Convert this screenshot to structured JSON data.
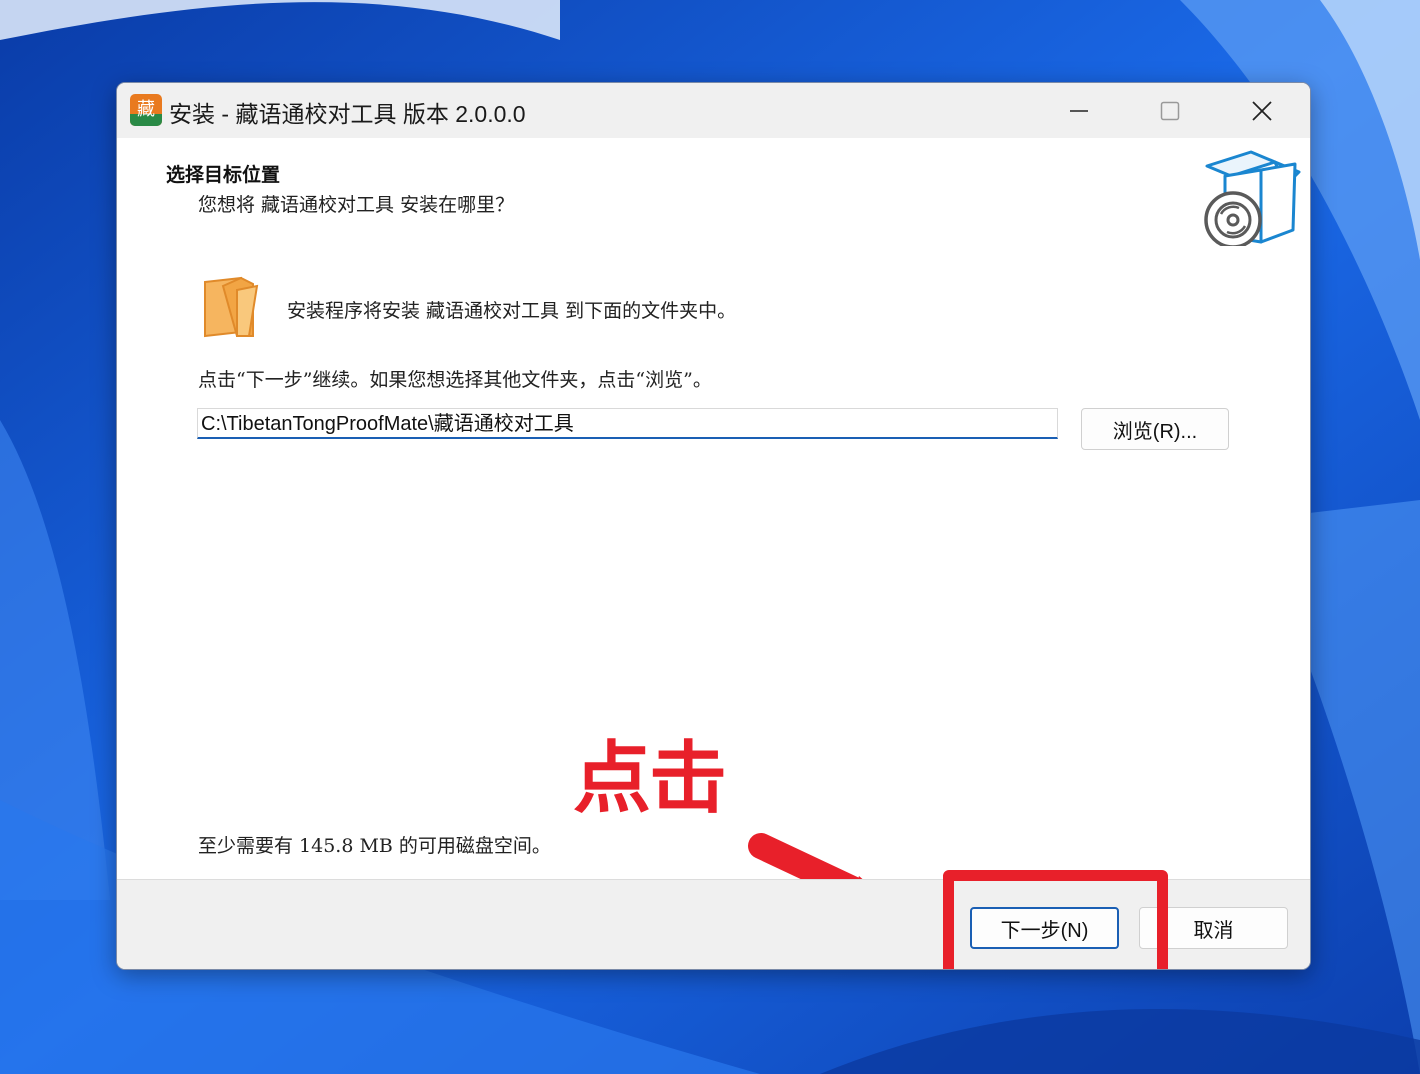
{
  "window": {
    "title": "安装 - 藏语通校对工具 版本 2.0.0.0",
    "app_icon_glyph": "藏",
    "controls": [
      "minimize-icon",
      "maximize-icon",
      "close-icon"
    ]
  },
  "page": {
    "heading": "选择目标位置",
    "subheading": "您想将 藏语通校对工具 安装在哪里？",
    "info_text": "安装程序将安装 藏语通校对工具 到下面的文件夹中。",
    "instruction": "点击“下一步”继续。如果您想选择其他文件夹，点击“浏览”。",
    "install_path": "C:\\TibetanTongProofMate\\藏语通校对工具",
    "browse_label": "浏览(R)...",
    "disk_space_text": "至少需要有 145.8 MB 的可用磁盘空间。"
  },
  "footer": {
    "next_label": "下一步(N)",
    "cancel_label": "取消"
  },
  "annotation": {
    "text": "点击",
    "color": "#e8202a"
  },
  "colors": {
    "accent": "#1a5fb4",
    "desktop_blue": "#1e63d8",
    "folder_orange": "#f6b55f"
  }
}
